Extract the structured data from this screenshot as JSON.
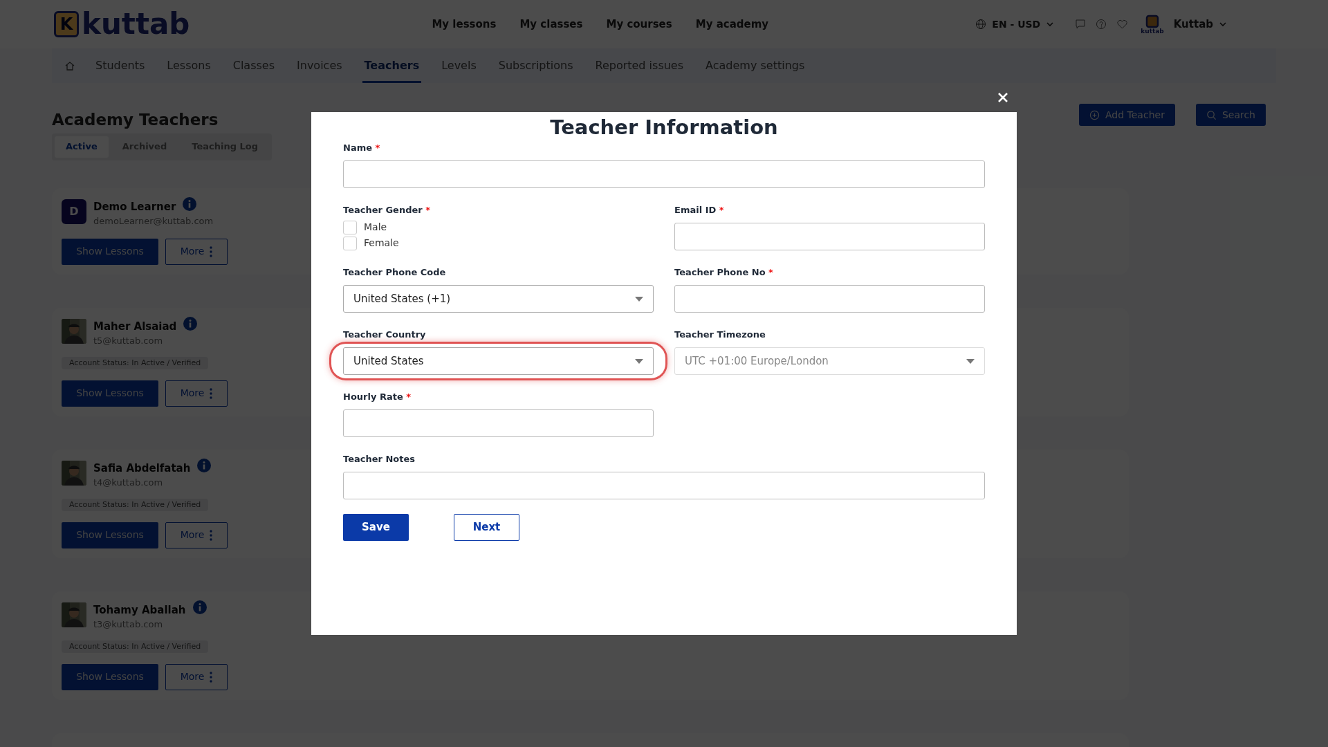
{
  "header": {
    "logo_mark": "K",
    "logo_text": "kuttab",
    "nav": [
      "My lessons",
      "My classes",
      "My courses",
      "My academy"
    ],
    "locale": "EN - USD",
    "account_caption": "kuttab",
    "account_name": "Kuttab"
  },
  "subnav": [
    {
      "label": "Students",
      "selected": false
    },
    {
      "label": "Lessons",
      "selected": false
    },
    {
      "label": "Classes",
      "selected": false
    },
    {
      "label": "Invoices",
      "selected": false
    },
    {
      "label": "Teachers",
      "selected": true
    },
    {
      "label": "Levels",
      "selected": false
    },
    {
      "label": "Subscriptions",
      "selected": false
    },
    {
      "label": "Reported issues",
      "selected": false
    },
    {
      "label": "Academy settings",
      "selected": false
    }
  ],
  "page_title": "Academy Teachers",
  "status_tabs": [
    {
      "label": "Active",
      "selected": true
    },
    {
      "label": "Archived",
      "selected": false
    },
    {
      "label": "Teaching Log",
      "selected": false
    }
  ],
  "actions": [
    {
      "label": "Add Teacher",
      "kind": "add"
    },
    {
      "label": "Search",
      "kind": "search"
    }
  ],
  "teachers": [
    {
      "name": "Demo Learner",
      "email": "demoLearner@kuttab.com",
      "avatar": {
        "kind": "letter",
        "letter": "D"
      },
      "show_button": "Show Lessons",
      "more_button": "More"
    },
    {
      "name": "Maher Alsaiad",
      "email": "t5@kuttab.com",
      "status": "Account Status: In Active / Verified",
      "show_button": "Show Lessons",
      "more_button": "More"
    },
    {
      "name": "Safia Abdelfatah",
      "email": "t4@kuttab.com",
      "status": "Account Status: In Active / Verified",
      "show_button": "Show Lessons",
      "more_button": "More"
    },
    {
      "name": "Tohamy Aballah",
      "email": "t3@kuttab.com",
      "status": "Account Status: In Active / Verified",
      "show_button": "Show Lessons",
      "more_button": "More"
    }
  ],
  "modal": {
    "title": "Teacher Information",
    "name_field": {
      "kind": "text",
      "label": "Name",
      "required_mark": "*"
    },
    "fields": [
      {
        "kind": "checkboxes",
        "label": "Teacher Gender",
        "required_mark": "*",
        "options": [
          {
            "label": "Male",
            "checked": false
          },
          {
            "label": "Female",
            "checked": false
          }
        ]
      },
      {
        "kind": "text",
        "label": "Email ID",
        "required_mark": "*"
      },
      {
        "kind": "select",
        "label": "Teacher Phone Code",
        "value": "United States (+1)",
        "disabled": false,
        "highlighted": false
      },
      {
        "kind": "text",
        "label": "Teacher Phone No",
        "required_mark": "*"
      },
      {
        "kind": "select",
        "label": "Teacher Country",
        "value": "United States",
        "disabled": false,
        "highlighted": true
      },
      {
        "kind": "select",
        "label": "Teacher Timezone",
        "value": "UTC +01:00 Europe/London",
        "disabled": true,
        "highlighted": false
      },
      {
        "kind": "text",
        "label": "Hourly Rate",
        "required_mark": "*"
      }
    ],
    "notes_field": {
      "kind": "text",
      "label": "Teacher Notes"
    },
    "buttons": [
      {
        "label": "Save",
        "kind": "primary"
      },
      {
        "label": "Next",
        "kind": "outline"
      }
    ]
  }
}
